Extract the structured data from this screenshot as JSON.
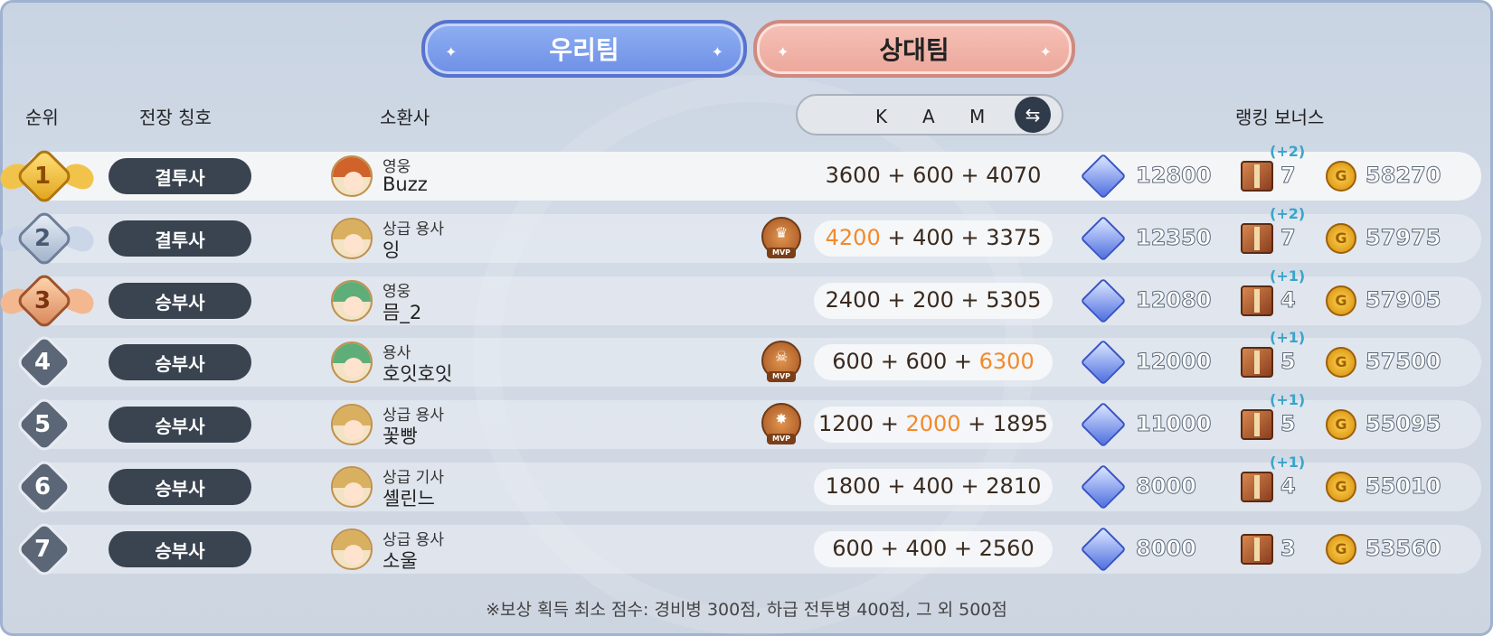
{
  "tabs": {
    "ours": "우리팀",
    "theirs": "상대팀"
  },
  "header": {
    "rank": "순위",
    "title": "전장 칭호",
    "summoner": "소환사",
    "k": "K",
    "a": "A",
    "m": "M",
    "bonus": "랭킹 보너스"
  },
  "mvp_label": "MVP",
  "rows": [
    {
      "rank": "1",
      "title": "결투사",
      "class": "영웅",
      "name": "Buzz",
      "k": "3600",
      "a": "600",
      "m": "4070",
      "hi": "",
      "mvp": false,
      "crystal": "12800",
      "box": "7",
      "box_bonus": "(+2)",
      "coin": "58270"
    },
    {
      "rank": "2",
      "title": "결투사",
      "class": "상급 용사",
      "name": "잉",
      "k": "4200",
      "a": "400",
      "m": "3375",
      "hi": "k",
      "mvp": true,
      "crystal": "12350",
      "box": "7",
      "box_bonus": "(+2)",
      "coin": "57975"
    },
    {
      "rank": "3",
      "title": "승부사",
      "class": "영웅",
      "name": "믐_2",
      "k": "2400",
      "a": "200",
      "m": "5305",
      "hi": "",
      "mvp": false,
      "crystal": "12080",
      "box": "4",
      "box_bonus": "(+1)",
      "coin": "57905"
    },
    {
      "rank": "4",
      "title": "승부사",
      "class": "용사",
      "name": "호잇호잇",
      "k": "600",
      "a": "600",
      "m": "6300",
      "hi": "m",
      "mvp": true,
      "crystal": "12000",
      "box": "5",
      "box_bonus": "(+1)",
      "coin": "57500"
    },
    {
      "rank": "5",
      "title": "승부사",
      "class": "상급 용사",
      "name": "꽃빵",
      "k": "1200",
      "a": "2000",
      "m": "1895",
      "hi": "a",
      "mvp": true,
      "crystal": "11000",
      "box": "5",
      "box_bonus": "(+1)",
      "coin": "55095"
    },
    {
      "rank": "6",
      "title": "승부사",
      "class": "상급 기사",
      "name": "셸린느",
      "k": "1800",
      "a": "400",
      "m": "2810",
      "hi": "",
      "mvp": false,
      "crystal": "8000",
      "box": "4",
      "box_bonus": "(+1)",
      "coin": "55010"
    },
    {
      "rank": "7",
      "title": "승부사",
      "class": "상급 용사",
      "name": "소울",
      "k": "600",
      "a": "400",
      "m": "2560",
      "hi": "",
      "mvp": false,
      "crystal": "8000",
      "box": "3",
      "box_bonus": "",
      "coin": "53560"
    }
  ],
  "footer": "※보상 획득 최소 점수: 경비병 300점, 하급 전투병 400점, 그 외 500점",
  "colors": {
    "highlight": "#f28a2a",
    "title_pill": "#3a4350",
    "tab_ours": "#7b99ea",
    "tab_theirs": "#f0b2a7"
  }
}
